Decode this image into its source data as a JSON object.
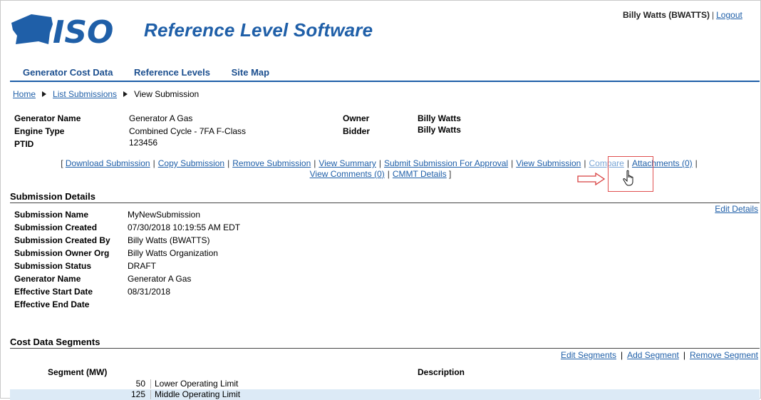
{
  "header": {
    "logo_text": "ISO",
    "app_title": "Reference Level Software",
    "user": "Billy Watts (BWATTS)",
    "logout": "Logout"
  },
  "nav": {
    "items": [
      "Generator Cost Data",
      "Reference Levels",
      "Site Map"
    ]
  },
  "breadcrumb": {
    "home": "Home",
    "list": "List Submissions",
    "current": "View Submission"
  },
  "summary": {
    "generator_name_label": "Generator Name",
    "generator_name": "Generator A Gas",
    "engine_type_label": "Engine Type",
    "engine_type": "Combined Cycle - 7FA F-Class",
    "ptid_label": "PTID",
    "ptid": "123456",
    "owner_label": "Owner",
    "owner": "Billy Watts",
    "bidder_label": "Bidder",
    "bidder": "Billy Watts"
  },
  "actions": {
    "open": "[",
    "close": "]",
    "download": "Download Submission",
    "copy": "Copy Submission",
    "remove": "Remove Submission",
    "view_summary": "View Summary",
    "submit": "Submit Submission For Approval",
    "view_submission": "View Submission",
    "compare": "Compare",
    "attachments": "Attachments (0)",
    "view_comments": "View Comments (0)",
    "cmmt": "CMMT Details"
  },
  "submission_details": {
    "title": "Submission Details",
    "edit": "Edit Details",
    "fields": [
      {
        "label": "Submission Name",
        "value": "MyNewSubmission"
      },
      {
        "label": "Submission Created",
        "value": "07/30/2018 10:19:55 AM EDT"
      },
      {
        "label": "Submission Created By",
        "value": "Billy Watts (BWATTS)"
      },
      {
        "label": "Submission Owner Org",
        "value": "Billy Watts Organization"
      },
      {
        "label": "Submission Status",
        "value": "DRAFT"
      },
      {
        "label": "Generator Name",
        "value": "Generator A Gas"
      },
      {
        "label": "Effective Start Date",
        "value": "08/31/2018"
      },
      {
        "label": "Effective End Date",
        "value": ""
      }
    ]
  },
  "cost_segments": {
    "title": "Cost Data Segments",
    "edit": "Edit Segments",
    "add": "Add Segment",
    "remove": "Remove Segment",
    "col_segment": "Segment (MW)",
    "col_description": "Description",
    "rows": [
      {
        "mw": "50",
        "desc": "Lower Operating Limit"
      },
      {
        "mw": "125",
        "desc": "Middle Operating Limit"
      }
    ]
  },
  "colors": {
    "brand": "#1f5fa8",
    "link": "#1f5fa8",
    "row_highlight": "#dceaf6",
    "highlight_box": "#e05050"
  },
  "icons": [
    "ny-state-logo-icon",
    "breadcrumb-arrow-icon",
    "red-arrow-icon",
    "hand-cursor-icon"
  ]
}
